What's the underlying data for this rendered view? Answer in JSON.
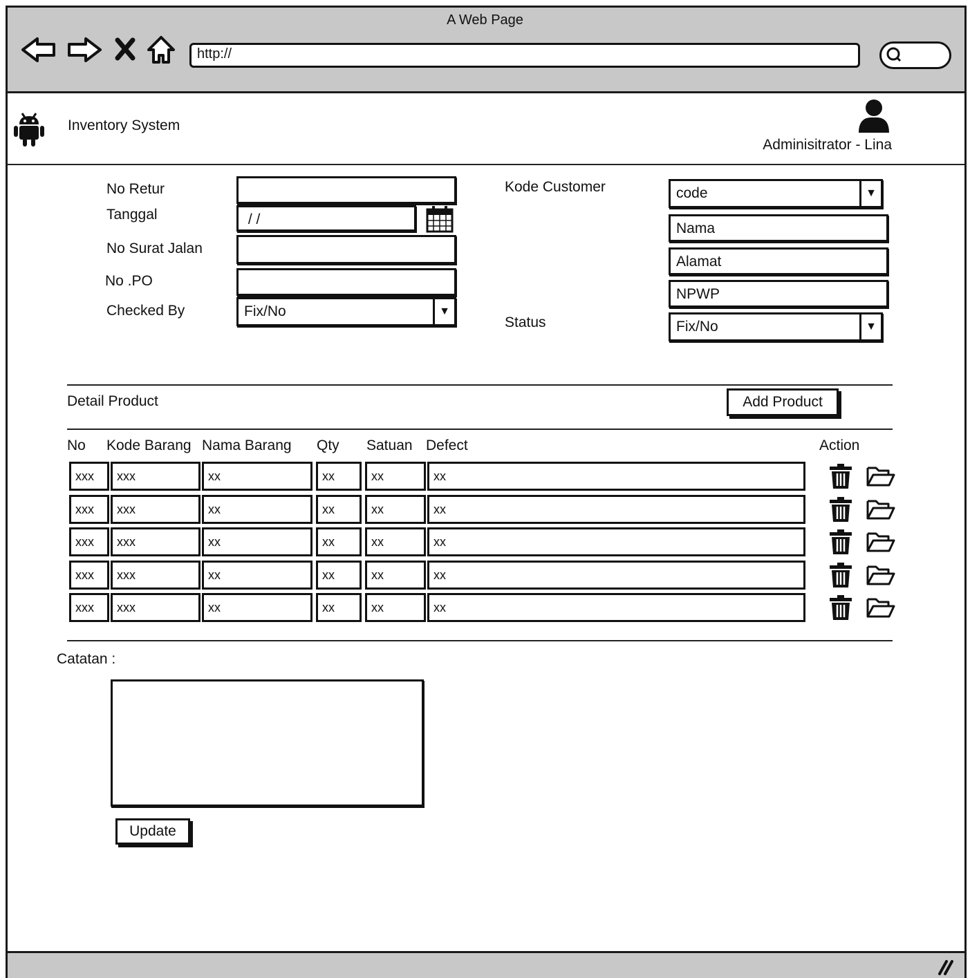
{
  "window": {
    "title": "A Web Page",
    "url": "http://"
  },
  "icons": {
    "back": "back-arrow-icon",
    "forward": "forward-arrow-icon",
    "stop": "close-icon",
    "home": "home-icon",
    "search": "search-icon",
    "logo": "android-icon",
    "user": "user-icon",
    "calendar": "calendar-icon",
    "delete": "trash-icon",
    "open": "folder-icon"
  },
  "header": {
    "app_title": "Inventory System",
    "user": "Adminisitrator - Lina"
  },
  "form": {
    "no_retur_label": "No Retur",
    "tanggal_label": "Tanggal",
    "tanggal_value": " / /",
    "no_surat_jalan_label": "No Surat Jalan",
    "no_po_label": "No .PO",
    "checked_by_label": "Checked By",
    "checked_by_value": "Fix/No",
    "kode_customer_label": "Kode Customer",
    "kode_customer_value": "code",
    "nama_value": "Nama",
    "alamat_value": "Alamat",
    "npwp_value": "NPWP",
    "status_label": "Status",
    "status_value": "Fix/No"
  },
  "detail": {
    "title": "Detail Product",
    "add_button": "Add Product",
    "columns": [
      "No",
      "Kode Barang",
      "Nama Barang",
      "Qty",
      "Satuan",
      "Defect",
      "Action"
    ],
    "rows": [
      [
        "xxx",
        "xxx",
        "xx",
        "xx",
        "xx",
        "xx"
      ],
      [
        "xxx",
        "xxx",
        "xx",
        "xx",
        "xx",
        "xx"
      ],
      [
        "xxx",
        "xxx",
        "xx",
        "xx",
        "xx",
        "xx"
      ],
      [
        "xxx",
        "xxx",
        "xx",
        "xx",
        "xx",
        "xx"
      ],
      [
        "xxx",
        "xxx",
        "xx",
        "xx",
        "xx",
        "xx"
      ]
    ]
  },
  "notes": {
    "label": "Catatan :",
    "value": "",
    "update_button": "Update"
  }
}
